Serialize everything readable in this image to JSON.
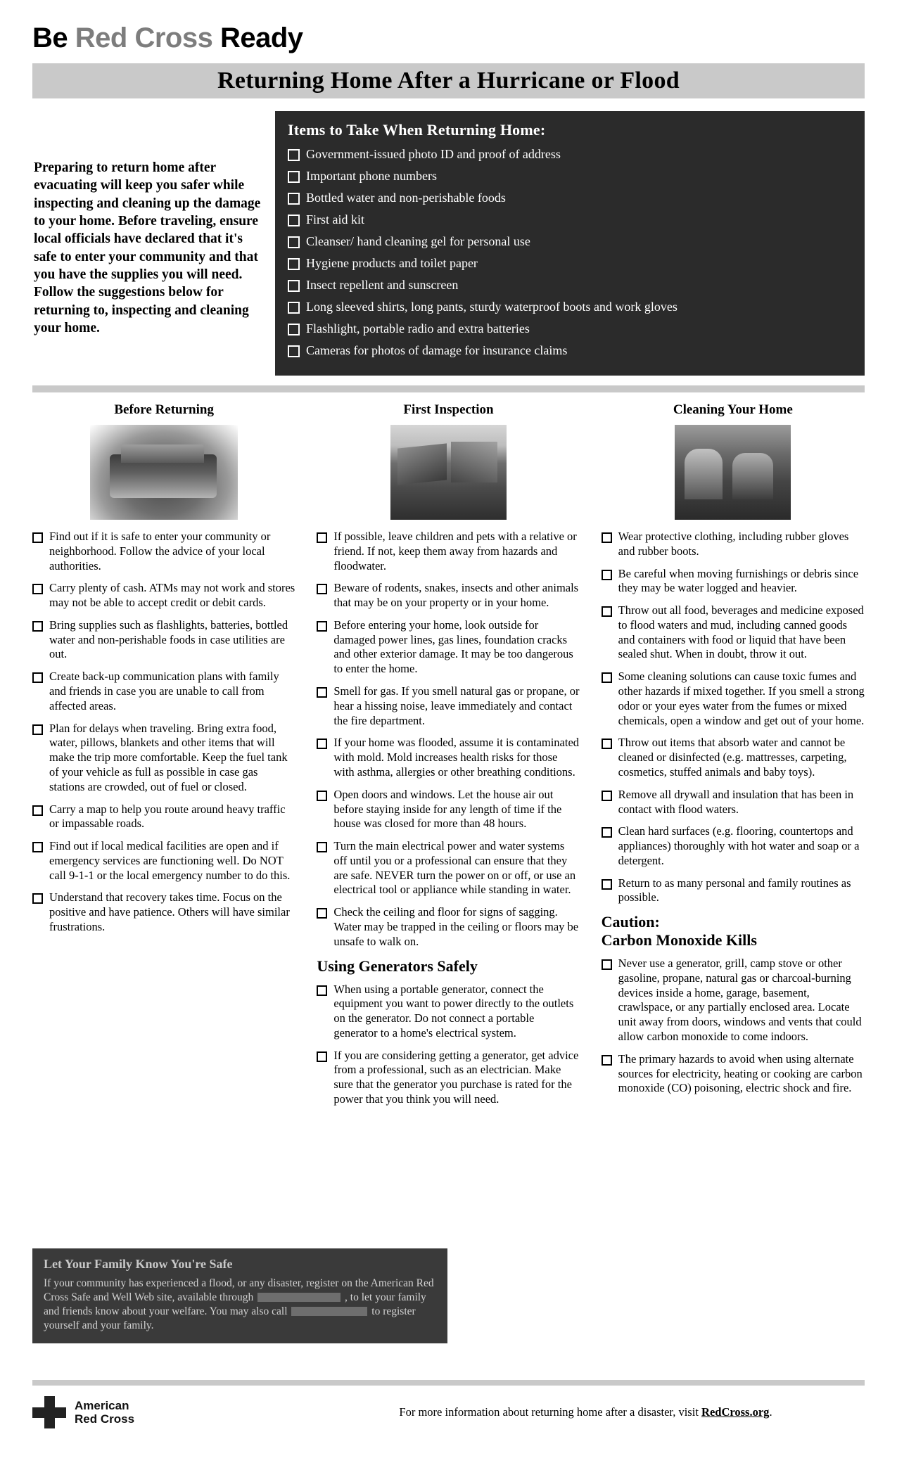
{
  "brand": {
    "prefix": "Be",
    "highlight": "Red Cross",
    "suffix": "Ready"
  },
  "banner": {
    "title": "Returning Home After a Hurricane or Flood"
  },
  "intro": {
    "text": "Preparing to return home after evacuating will keep you safer while inspecting and cleaning up the damage to your home.  Before traveling, ensure local officials have declared that it's safe to enter your community and that you have the supplies you will need. Follow the suggestions below for returning to, inspecting and cleaning your home."
  },
  "items_box": {
    "heading": "Items to Take When Returning Home:",
    "items": [
      "Government-issued photo ID and proof of address",
      "Important phone numbers",
      "Bottled water and non-perishable foods",
      "First aid kit",
      "Cleanser/ hand cleaning gel for personal use",
      "Hygiene products and toilet paper",
      "Insect repellent and sunscreen",
      "Long sleeved shirts, long pants, sturdy waterproof boots and work gloves",
      "Flashlight, portable radio and extra batteries",
      "Cameras for photos of damage for insurance claims"
    ]
  },
  "columns": [
    {
      "heading": "Before Returning",
      "photo": "supply-kit-photo",
      "items": [
        "Find out if it is safe to enter your community or neighborhood. Follow the advice of your local authorities.",
        "Carry plenty of cash. ATMs may not work and stores may not be able to accept credit or debit cards.",
        "Bring supplies such as flashlights, batteries, bottled water and non-perishable foods in case utilities are out.",
        "Create back-up communication plans with family and friends in case you are unable to call from affected areas.",
        "Plan for delays when traveling. Bring extra food, water, pillows, blankets and other items that will make the trip more comfortable. Keep the fuel tank of your vehicle as full as possible in case gas stations are crowded, out of fuel or closed.",
        "Carry a map to help you route around heavy traffic or impassable roads.",
        "Find out if local medical facilities are open and if emergency services are functioning well. Do NOT call 9-1-1 or the local emergency number to do this.",
        "Understand that recovery takes time. Focus on the positive and have patience. Others will have similar frustrations."
      ]
    },
    {
      "heading": "First Inspection",
      "photo": "damaged-house-photo",
      "items": [
        "If possible, leave children and pets with a relative or friend. If not, keep them away from hazards and floodwater.",
        "Beware of rodents, snakes, insects and other animals that may be on your property or in your home.",
        "Before entering your home, look outside for damaged power lines, gas lines, foundation cracks and other exterior damage. It may be too dangerous to enter the home.",
        "Smell for gas. If you smell natural gas or propane, or hear a hissing noise, leave immediately and contact the fire department.",
        "If your home was flooded, assume it is contaminated with mold. Mold increases health risks for those with asthma, allergies or other breathing conditions.",
        "Open doors and windows. Let the house air out before staying inside for any length of time if the house was closed for more than 48 hours.",
        "Turn the main electrical power and water systems off until you or a professional can ensure that they are safe. NEVER turn the power on or off, or use an electrical tool or appliance while standing in water.",
        "Check the ceiling and floor for signs of sagging. Water may be trapped in the ceiling or floors may be unsafe to walk on."
      ],
      "subsection": {
        "heading": "Using Generators Safely",
        "items": [
          "When using a portable generator, connect the equipment you want to power directly to the outlets on the generator.  Do not connect a portable generator to a home's electrical system.",
          "If you are considering getting a generator, get advice from a professional, such as an electrician.  Make sure that the generator you purchase is rated for the power that you think you will need."
        ]
      }
    },
    {
      "heading": "Cleaning Your Home",
      "photo": "cleaning-volunteers-photo",
      "items": [
        "Wear protective clothing, including rubber gloves and rubber boots.",
        "Be careful when moving furnishings or debris since they may be water logged and heavier.",
        "Throw out all food, beverages and medicine exposed to flood waters and mud, including canned goods and containers with food or liquid that have been sealed shut. When in doubt, throw it out.",
        "Some cleaning solutions can cause toxic fumes and other hazards if mixed together. If you smell a strong odor or your eyes water from the fumes or mixed chemicals, open a window and get out of your home.",
        "Throw out items that absorb water and cannot be cleaned or disinfected (e.g. mattresses, carpeting, cosmetics, stuffed animals and baby toys).",
        "Remove all drywall and insulation that has been in contact with flood waters.",
        "Clean hard surfaces (e.g. flooring, countertops and appliances) thoroughly with hot water and soap or a detergent.",
        "Return to as many personal and family routines as possible."
      ],
      "subsection": {
        "heading_line1": "Caution:",
        "heading_line2": "Carbon Monoxide Kills",
        "items": [
          "Never use a generator, grill, camp stove or other gasoline, propane, natural gas or charcoal-burning devices inside a home, garage, basement, crawlspace, or any partially enclosed area.  Locate unit away from doors, windows and vents that could allow carbon monoxide to come indoors.",
          "The primary hazards to avoid when using alternate sources for electricity, heating or cooking are carbon monoxide (CO) poisoning, electric shock and fire."
        ]
      }
    }
  ],
  "safe_box": {
    "heading": "Let Your Family Know You're Safe",
    "text_part1": "If your community has experienced a flood, or any disaster, register on the American Red Cross Safe and Well Web site, available through",
    "text_part2": ", to let your family and friends know about your welfare. You may also call",
    "text_part3": "to register yourself and your family."
  },
  "footer": {
    "logo_line1": "American",
    "logo_line2": "Red Cross",
    "note_text": "For more information about returning home after a disaster, visit",
    "note_url": "RedCross.org",
    "note_end": "."
  }
}
